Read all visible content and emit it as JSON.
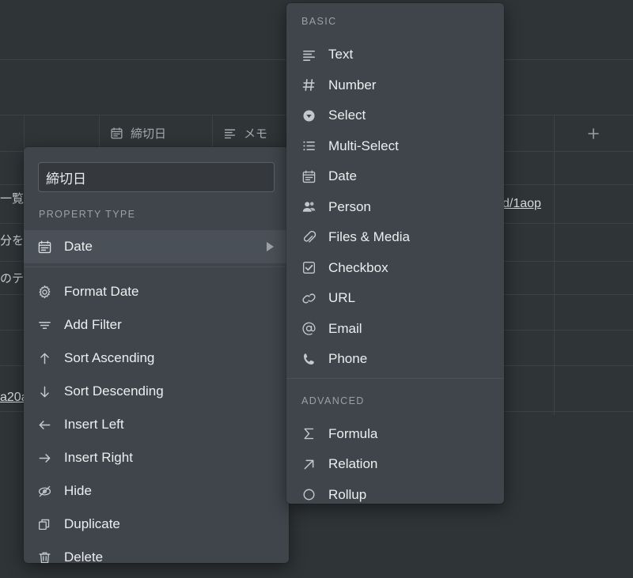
{
  "background": {
    "columns": [
      {
        "icon": "date-icon",
        "label": "締切日"
      },
      {
        "icon": "text-icon",
        "label": "メモ"
      }
    ],
    "add_column_label": "+",
    "cells": [
      {
        "text": "一覧"
      },
      {
        "text": "分を"
      },
      {
        "text": "のテ"
      },
      {
        "text": "a20a"
      },
      {
        "text": "d/1aop"
      }
    ]
  },
  "property_menu": {
    "name_value": "締切日",
    "name_placeholder": "",
    "section_label": "PROPERTY TYPE",
    "current_type": {
      "icon": "date-icon",
      "label": "Date",
      "caret": "▶"
    },
    "actions": [
      {
        "icon": "gear-icon",
        "label": "Format Date"
      },
      {
        "icon": "filter-icon",
        "label": "Add Filter"
      },
      {
        "icon": "arrow-up-icon",
        "label": "Sort Ascending"
      },
      {
        "icon": "arrow-down-icon",
        "label": "Sort Descending"
      },
      {
        "icon": "arrow-left-icon",
        "label": "Insert Left"
      },
      {
        "icon": "arrow-right-icon",
        "label": "Insert Right"
      },
      {
        "icon": "eye-off-icon",
        "label": "Hide"
      },
      {
        "icon": "duplicate-icon",
        "label": "Duplicate"
      },
      {
        "icon": "trash-icon",
        "label": "Delete"
      }
    ]
  },
  "type_menu": {
    "basic_label": "BASIC",
    "basic_items": [
      {
        "icon": "text-icon",
        "label": "Text"
      },
      {
        "icon": "number-icon",
        "label": "Number"
      },
      {
        "icon": "select-icon",
        "label": "Select"
      },
      {
        "icon": "multi-select-icon",
        "label": "Multi-Select"
      },
      {
        "icon": "date-icon",
        "label": "Date"
      },
      {
        "icon": "person-icon",
        "label": "Person"
      },
      {
        "icon": "paperclip-icon",
        "label": "Files & Media"
      },
      {
        "icon": "checkbox-icon",
        "label": "Checkbox"
      },
      {
        "icon": "link-icon",
        "label": "URL"
      },
      {
        "icon": "at-icon",
        "label": "Email"
      },
      {
        "icon": "phone-icon",
        "label": "Phone"
      }
    ],
    "advanced_label": "ADVANCED",
    "advanced_items": [
      {
        "icon": "sigma-icon",
        "label": "Formula"
      },
      {
        "icon": "arrow-diagonal-icon",
        "label": "Relation"
      },
      {
        "icon": "rollup-icon",
        "label": "Rollup"
      }
    ]
  },
  "colors": {
    "page_background": "#2f3437",
    "menu_background": "#40454b",
    "menu_selected": "#4a5057",
    "text_primary": "#eceef0",
    "text_muted": "#9aa0a5",
    "grid_line": "#3d4245"
  }
}
